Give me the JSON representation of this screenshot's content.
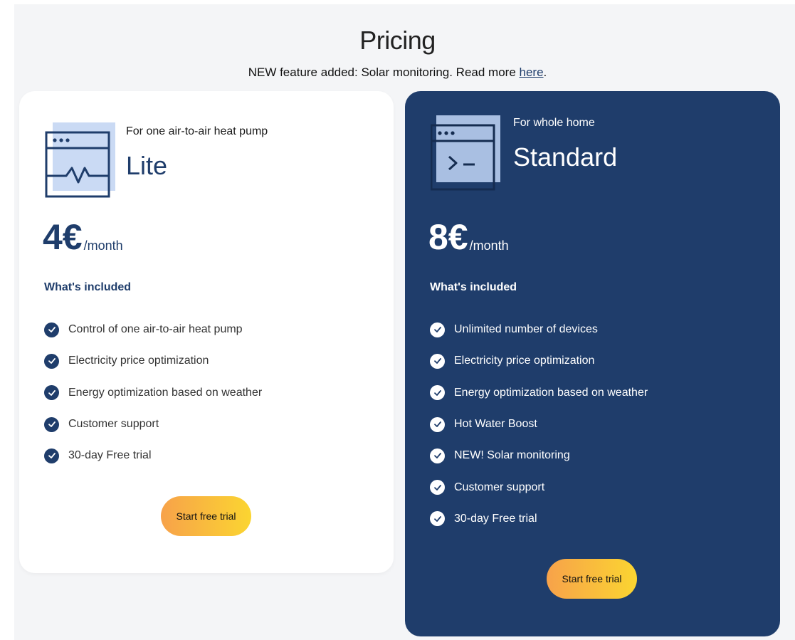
{
  "header": {
    "title": "Pricing",
    "announcement_text": "NEW feature added: Solar monitoring. Read more ",
    "announcement_link": "here",
    "announcement_end": "."
  },
  "plans": [
    {
      "subtitle": "For one air-to-air heat pump",
      "name": "Lite",
      "price": "4€",
      "period": "/month",
      "included_heading": "What's included",
      "features": [
        "Control of one air-to-air heat pump",
        "Electricity price optimization",
        "Energy optimization based on weather",
        "Customer support",
        "30-day Free trial"
      ],
      "cta_label": "Start free trial",
      "icon": "monitor-waveform-icon"
    },
    {
      "subtitle": "For whole home",
      "name": "Standard",
      "price": "8€",
      "period": "/month",
      "included_heading": "What's included",
      "features": [
        "Unlimited number of devices",
        "Electricity price optimization",
        "Energy optimization based on weather",
        "Hot Water Boost",
        "NEW! Solar monitoring",
        "Customer support",
        "30-day Free trial"
      ],
      "cta_label": "Start free trial",
      "icon": "terminal-window-icon"
    }
  ],
  "colors": {
    "brand_navy": "#1f3d6b",
    "cta_gradient_start": "#f7a24a",
    "cta_gradient_end": "#fbd531",
    "icon_accent": "#b8cdf0",
    "page_background": "#f4f5f7"
  }
}
